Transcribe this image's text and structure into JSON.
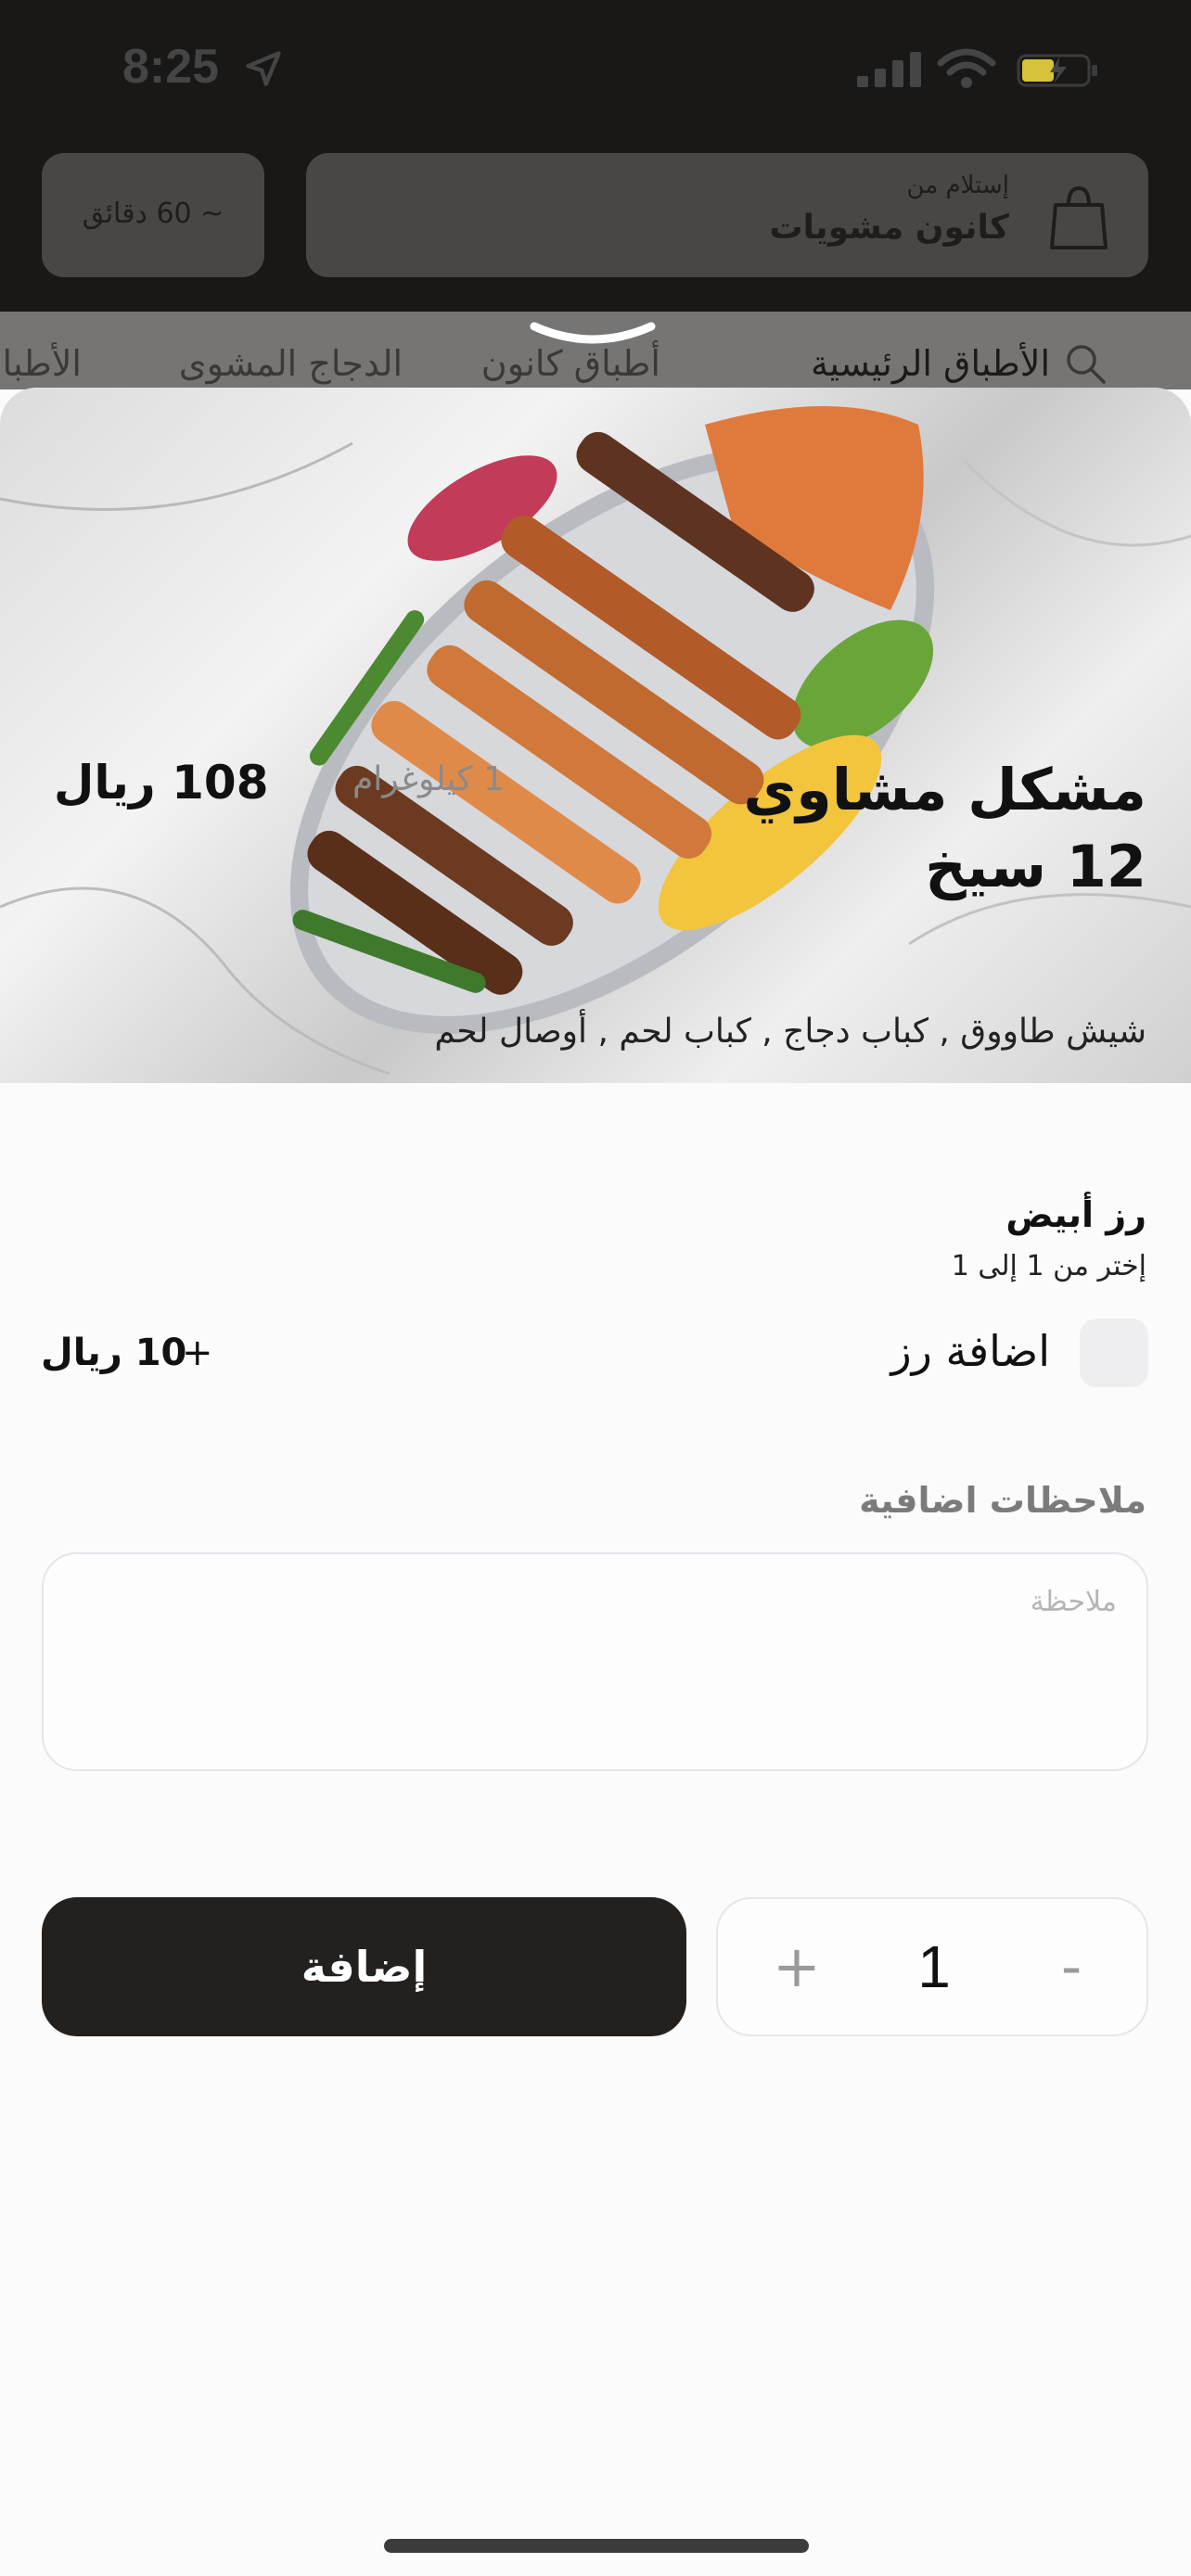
{
  "status_bar": {
    "time": "8:25"
  },
  "header": {
    "pickup_label": "إستلام من",
    "pickup_name": "كانون مشويات",
    "pickup_time": "~ 60 دقائق"
  },
  "categories": [
    {
      "label": "الأطباق الرئيسية",
      "active": true
    },
    {
      "label": "أطباق كانون",
      "active": false
    },
    {
      "label": "الدجاج المشوى",
      "active": false
    },
    {
      "label": "الأطباق",
      "active": false
    }
  ],
  "product": {
    "image_alt": "mixed-grill-platter",
    "title": "مشكل مشاوي 12 سيخ",
    "weight": "1 كيلوغرام",
    "price": "108 ريال",
    "description": "شيش طاووق , كباب دجاج , كباب لحم , أوصال لحم"
  },
  "options": {
    "group_title": "رز أبيض",
    "group_subtitle": "إختر من 1 إلى 1",
    "items": [
      {
        "label": "اضافة رز",
        "plus": "+",
        "price": "10 ريال",
        "checked": false
      }
    ]
  },
  "notes": {
    "label": "ملاحظات اضافية",
    "placeholder": "ملاحظة",
    "value": ""
  },
  "actions": {
    "add_label": "إضافة",
    "quantity": "1",
    "plus": "+",
    "minus": "-"
  },
  "colors": {
    "primary_button": "#23201d",
    "dim_overlay": "#1a1816"
  }
}
